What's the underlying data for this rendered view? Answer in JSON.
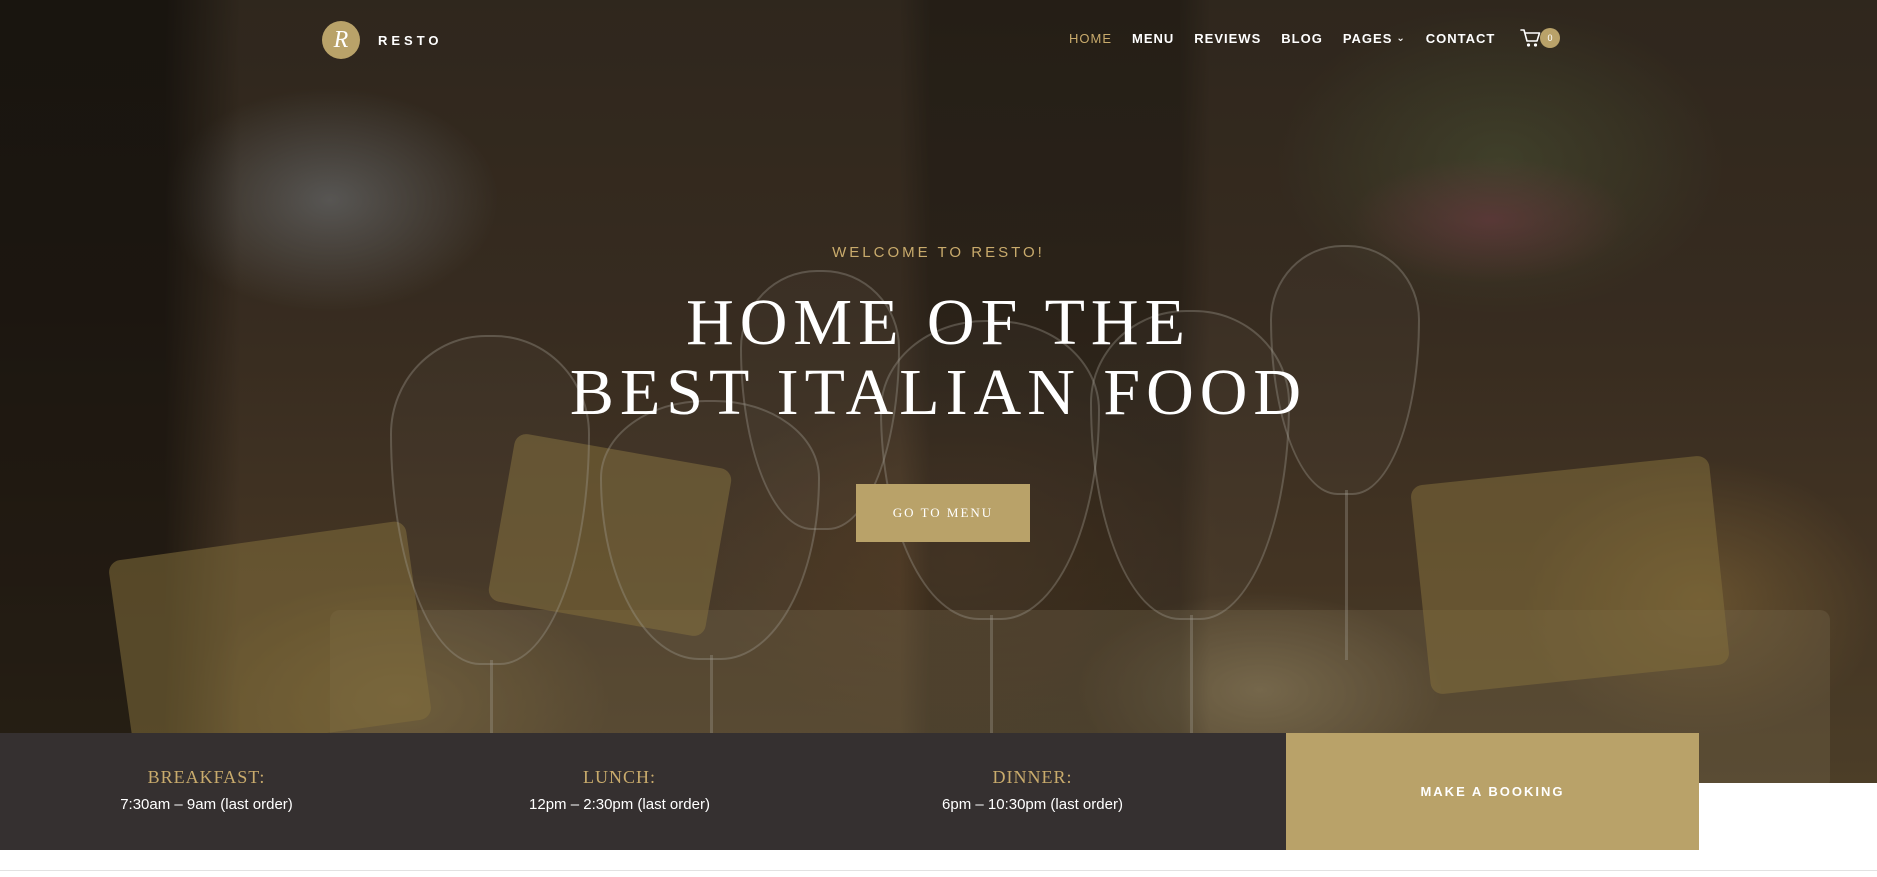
{
  "brand": {
    "logo_letter": "R",
    "name": "RESTO",
    "accent": "#b9a269"
  },
  "nav": {
    "items": [
      {
        "label": "HOME",
        "active": true
      },
      {
        "label": "MENU"
      },
      {
        "label": "REVIEWS"
      },
      {
        "label": "BLOG"
      },
      {
        "label": "PAGES",
        "has_dropdown": true
      },
      {
        "label": "CONTACT"
      }
    ],
    "cart_icon": "shopping-cart-icon",
    "cart_count": "0"
  },
  "hero": {
    "kicker": "WELCOME TO RESTO!",
    "headline_line1": "HOME OF THE",
    "headline_line2": "BEST ITALIAN FOOD",
    "cta_label": "GO TO MENU"
  },
  "hours": [
    {
      "label": "BREAKFAST:",
      "time": "7:30am – 9am (last order)"
    },
    {
      "label": "LUNCH:",
      "time": "12pm – 2:30pm (last order)"
    },
    {
      "label": "DINNER:",
      "time": "6pm – 10:30pm (last order)"
    }
  ],
  "booking_label": "MAKE A BOOKING",
  "colors": {
    "gold": "#b9a269",
    "gold_text": "#c9ab6c",
    "dark_bar": "#353030"
  }
}
